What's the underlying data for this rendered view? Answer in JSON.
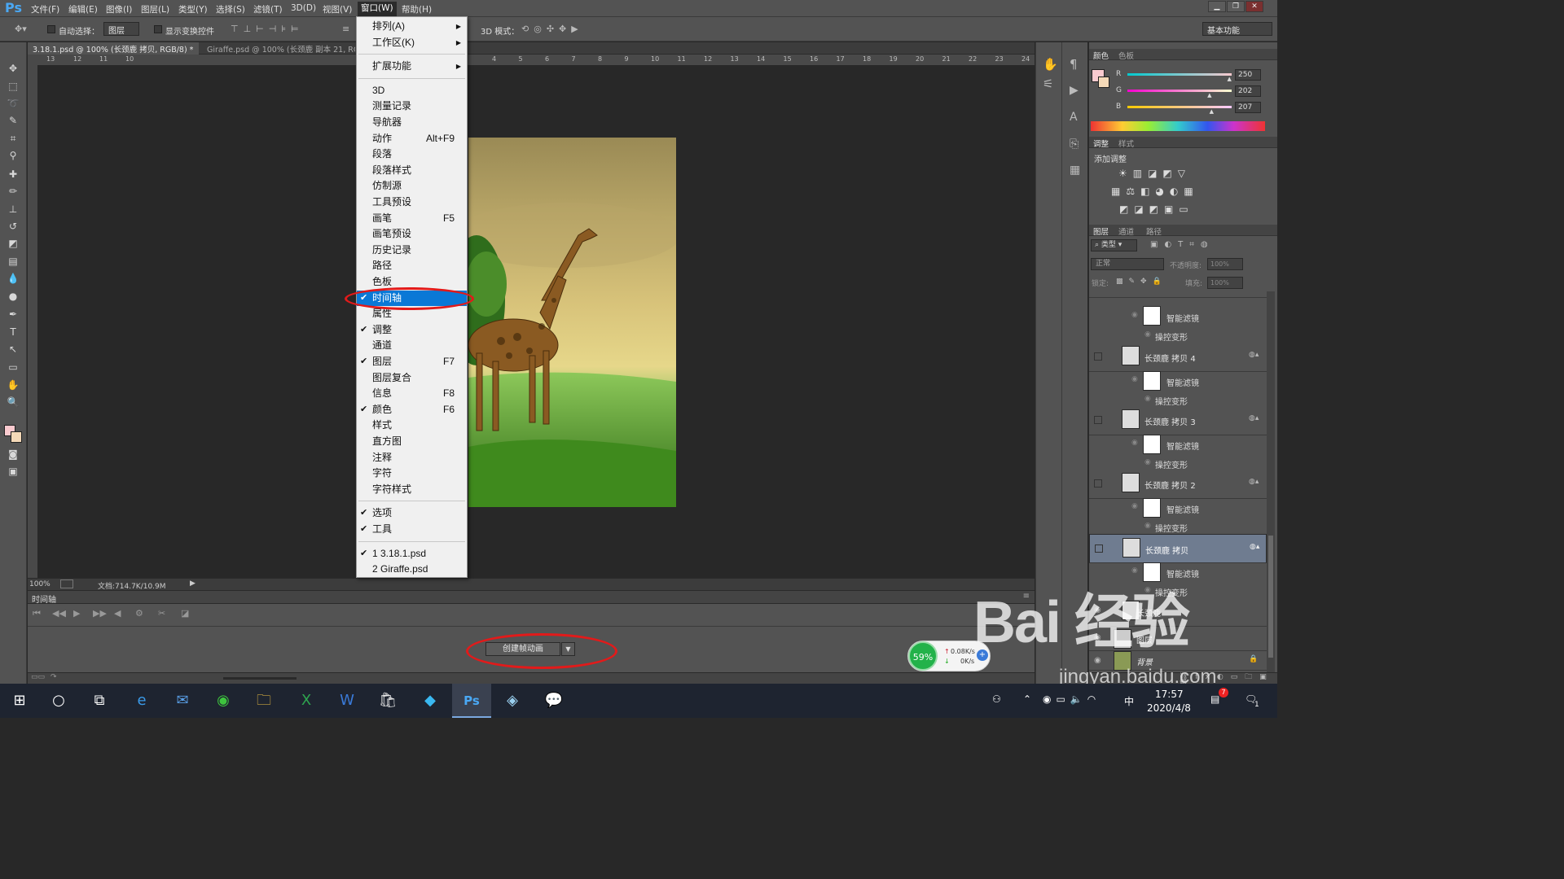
{
  "app": {
    "logo": "Ps"
  },
  "menubar": {
    "items": [
      "文件(F)",
      "编辑(E)",
      "图像(I)",
      "图层(L)",
      "类型(Y)",
      "选择(S)",
      "滤镜(T)",
      "3D(D)",
      "视图(V)",
      "窗口(W)",
      "帮助(H)"
    ],
    "active": "窗口(W)"
  },
  "options": {
    "auto_select_label": "自动选择：",
    "auto_select_value": "图层",
    "show_transform": "显示变换控件",
    "mode_3d": "3D 模式：",
    "workspace": "基本功能"
  },
  "documents": {
    "tab1": "3.18.1.psd @ 100% (长颈鹿 拷贝, RGB/8) *",
    "tab2": "Giraffe.psd @ 100% (长颈鹿 副本 21, RG"
  },
  "ruler": {
    "left": [
      "13",
      "12",
      "11",
      "10"
    ],
    "right": [
      "4",
      "5",
      "6",
      "7",
      "8",
      "9",
      "10",
      "11",
      "12",
      "13",
      "14",
      "15",
      "16",
      "17",
      "18",
      "19",
      "20",
      "21",
      "22",
      "23",
      "24"
    ]
  },
  "status": {
    "zoom": "100%",
    "doc": "文档:714.7K/10.9M"
  },
  "timeline": {
    "title": "时间轴",
    "create_button": "创建帧动画"
  },
  "window_menu": {
    "top": [
      {
        "label": "排列(A)",
        "arrow": true
      },
      {
        "label": "工作区(K)",
        "arrow": true
      }
    ],
    "mid": [
      {
        "label": "扩展功能",
        "arrow": true
      }
    ],
    "panels": [
      {
        "label": "3D",
        "check": false,
        "sc": ""
      },
      {
        "label": "测量记录",
        "check": false,
        "sc": ""
      },
      {
        "label": "导航器",
        "check": false,
        "sc": ""
      },
      {
        "label": "动作",
        "check": false,
        "sc": "Alt+F9"
      },
      {
        "label": "段落",
        "check": false,
        "sc": ""
      },
      {
        "label": "段落样式",
        "check": false,
        "sc": ""
      },
      {
        "label": "仿制源",
        "check": false,
        "sc": ""
      },
      {
        "label": "工具预设",
        "check": false,
        "sc": ""
      },
      {
        "label": "画笔",
        "check": false,
        "sc": "F5"
      },
      {
        "label": "画笔预设",
        "check": false,
        "sc": ""
      },
      {
        "label": "历史记录",
        "check": false,
        "sc": ""
      },
      {
        "label": "路径",
        "check": false,
        "sc": ""
      },
      {
        "label": "色板",
        "check": false,
        "sc": ""
      },
      {
        "label": "时间轴",
        "check": true,
        "sc": "",
        "highlight": true
      },
      {
        "label": "属性",
        "check": false,
        "sc": ""
      },
      {
        "label": "调整",
        "check": true,
        "sc": ""
      },
      {
        "label": "通道",
        "check": false,
        "sc": ""
      },
      {
        "label": "图层",
        "check": true,
        "sc": "F7"
      },
      {
        "label": "图层复合",
        "check": false,
        "sc": ""
      },
      {
        "label": "信息",
        "check": false,
        "sc": "F8"
      },
      {
        "label": "颜色",
        "check": true,
        "sc": "F6"
      },
      {
        "label": "样式",
        "check": false,
        "sc": ""
      },
      {
        "label": "直方图",
        "check": false,
        "sc": ""
      },
      {
        "label": "注释",
        "check": false,
        "sc": ""
      },
      {
        "label": "字符",
        "check": false,
        "sc": ""
      },
      {
        "label": "字符样式",
        "check": false,
        "sc": ""
      }
    ],
    "options": [
      {
        "label": "选项",
        "check": true
      },
      {
        "label": "工具",
        "check": true
      }
    ],
    "files": [
      {
        "label": "1 3.18.1.psd",
        "check": true
      },
      {
        "label": "2 Giraffe.psd",
        "check": false
      }
    ]
  },
  "color_panel": {
    "tabs": [
      "颜色",
      "色板"
    ],
    "r_label": "R",
    "g_label": "G",
    "b_label": "B",
    "r": "250",
    "g": "202",
    "b": "207",
    "r_frac": 0.98,
    "g_frac": 0.79,
    "b_frac": 0.81,
    "swatch": "#facacf"
  },
  "adjust_panel": {
    "tabs": [
      "调整",
      "样式"
    ],
    "title": "添加调整"
  },
  "layers_panel": {
    "tabs": [
      "图层",
      "通道",
      "路径"
    ],
    "filter": "类型",
    "blend": "正常",
    "opacity_label": "不透明度:",
    "opacity": "100%",
    "lock_label": "锁定:",
    "fill_label": "填充:",
    "fill": "100%",
    "smart_filter": "智能滤镜",
    "warp": "操控变形",
    "layers": [
      "长颈鹿 拷贝 4",
      "长颈鹿 拷贝 3",
      "长颈鹿 拷贝 2",
      "长颈鹿 拷贝",
      "长颈鹿",
      "图层",
      "背景"
    ]
  },
  "network": {
    "percent": "59%",
    "up": "0.08K/s",
    "down": "0K/s"
  },
  "taskbar": {
    "time": "17:57",
    "date": "2020/4/8",
    "lang": "中",
    "notif": "7",
    "badge": "1"
  },
  "watermark": {
    "brand": "Bai 经验",
    "url": "jingyan.baidu.com"
  },
  "colors": {
    "highlight": "#0a78d6",
    "annotation": "#e21a1a",
    "selected_layer": "#6f7c90"
  }
}
